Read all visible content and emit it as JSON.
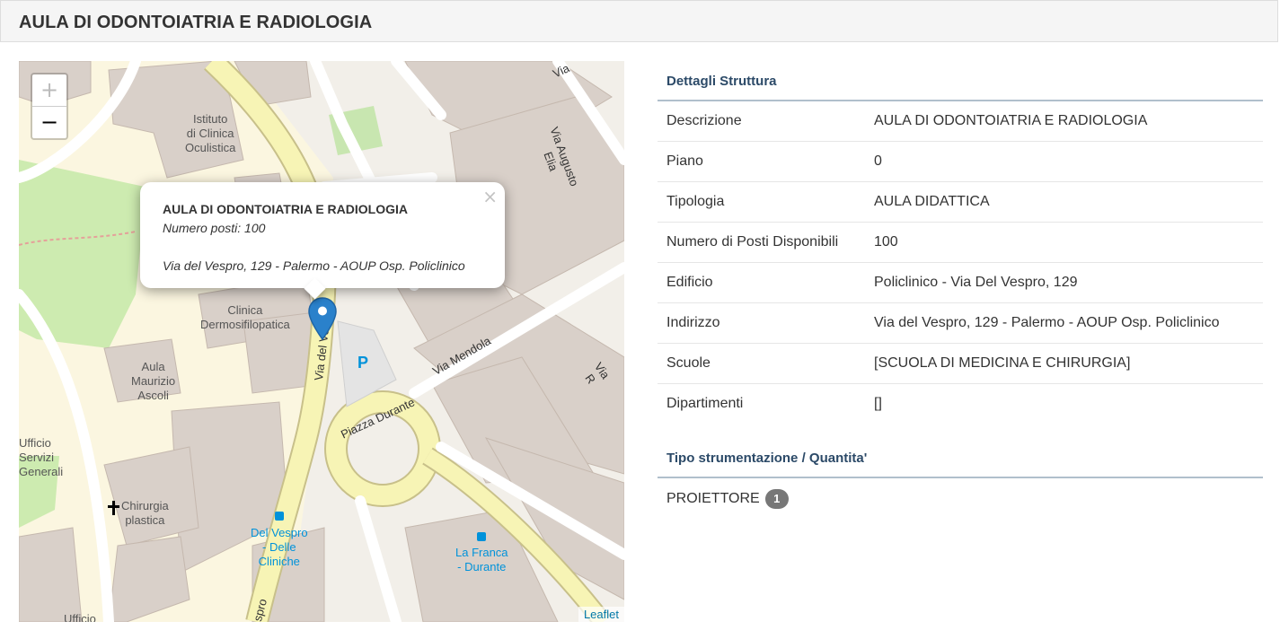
{
  "page": {
    "title": "AULA DI ODONTOIATRIA E RADIOLOGIA"
  },
  "map": {
    "zoom_in": "+",
    "zoom_out": "−",
    "attribution": "Leaflet",
    "popup": {
      "title": "AULA DI ODONTOIATRIA E RADIOLOGIA",
      "seats": "Numero posti: 100",
      "address": "Via del Vespro, 129 - Palermo - AOUP Osp. Policlinico",
      "close": "×"
    },
    "labels": {
      "istituto": "Istituto\ndi Clinica\nOculistica",
      "clinica": "Clinica\nDermosifilopatica",
      "aula_maurizio": "Aula\nMaurizio\nAscoli",
      "ufficio": "Ufficio\nServizi\nGenerali",
      "chirurgia": "Chirurgia\nplastica",
      "del_vespro_stop": "Del Vespro\n- Delle\nCliniche",
      "la_franca": "La Franca\n- Durante",
      "ufficio_bottom": "Ufficio",
      "via_augusto_elia": "Via Augusto Elia",
      "via_mendola": "Via Mendola",
      "piazza_durante": "Piazza Durante",
      "via_del_vespro": "Via del Vespro",
      "via_vespro_bottom": "spro",
      "via_top": "Via",
      "via_right": "Via R",
      "parking": "P"
    }
  },
  "details": {
    "section_title": "Dettagli Struttura",
    "rows": [
      {
        "label": "Descrizione",
        "value": "AULA DI ODONTOIATRIA E RADIOLOGIA"
      },
      {
        "label": "Piano",
        "value": "0"
      },
      {
        "label": "Tipologia",
        "value": "AULA DIDATTICA"
      },
      {
        "label": "Numero di Posti Disponibili",
        "value": "100"
      },
      {
        "label": "Edificio",
        "value": "Policlinico - Via Del Vespro, 129"
      },
      {
        "label": "Indirizzo",
        "value": "Via del Vespro, 129 - Palermo - AOUP Osp. Policlinico"
      },
      {
        "label": "Scuole",
        "value": "[SCUOLA DI MEDICINA E CHIRURGIA]"
      },
      {
        "label": "Dipartimenti",
        "value": "[]"
      }
    ]
  },
  "equipment": {
    "section_title": "Tipo strumentazione / Quantita'",
    "items": [
      {
        "name": "PROIETTORE",
        "quantity": "1"
      }
    ]
  }
}
